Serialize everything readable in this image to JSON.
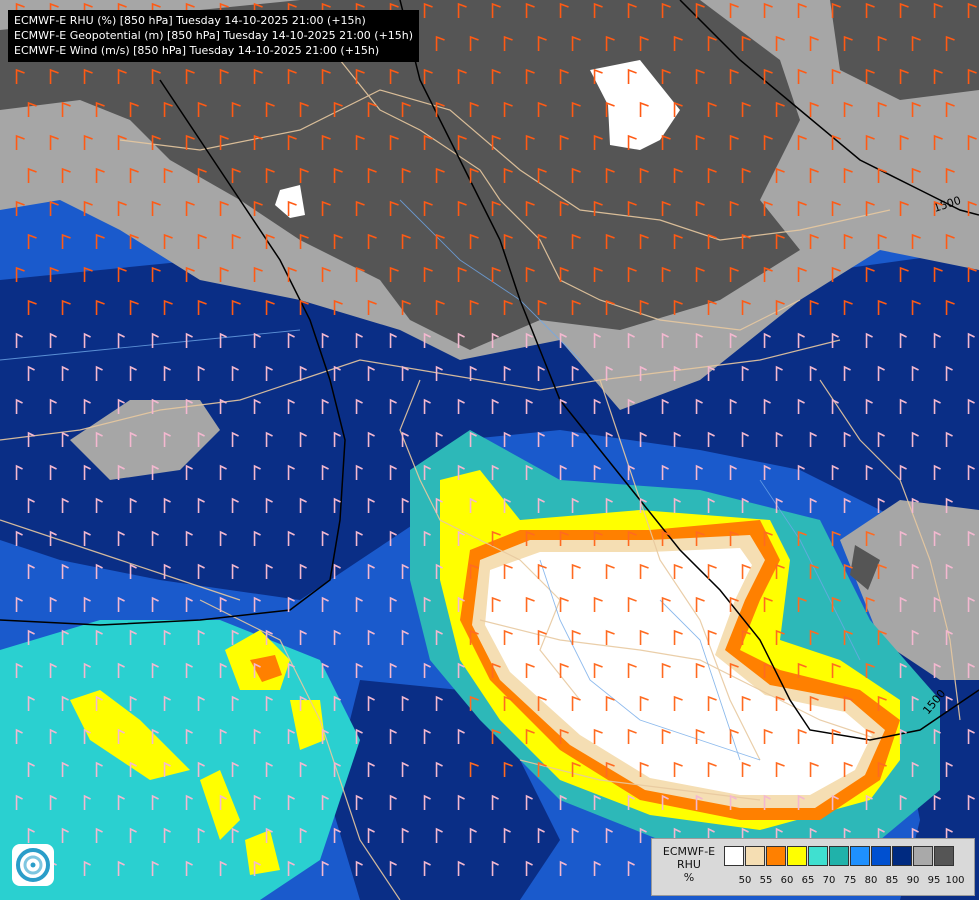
{
  "header": {
    "lines": [
      "ECMWF-E RHU (%) [850 hPa] Tuesday 14-10-2025 21:00 (+15h)",
      "ECMWF-E Geopotential (m) [850 hPa] Tuesday 14-10-2025 21:00 (+15h)",
      "ECMWF-E Wind (m/s) [850 hPa] Tuesday 14-10-2025 21:00 (+15h)"
    ]
  },
  "contours": {
    "labels": [
      "1500",
      "1500"
    ]
  },
  "legend": {
    "model": "ECMWF-E",
    "variable": "RHU",
    "unit": "%",
    "ticks": [
      "50",
      "55",
      "60",
      "65",
      "70",
      "75",
      "80",
      "85",
      "90",
      "95",
      "100"
    ],
    "colors": [
      "#ffffff",
      "#f5deb3",
      "#ff8000",
      "#ffff00",
      "#40e0d0",
      "#20b2aa",
      "#1e90ff",
      "#0050d0",
      "#002a80",
      "#a9a9a9",
      "#555555"
    ]
  },
  "logo": {
    "icon": "ecmwf-logo-icon"
  }
}
